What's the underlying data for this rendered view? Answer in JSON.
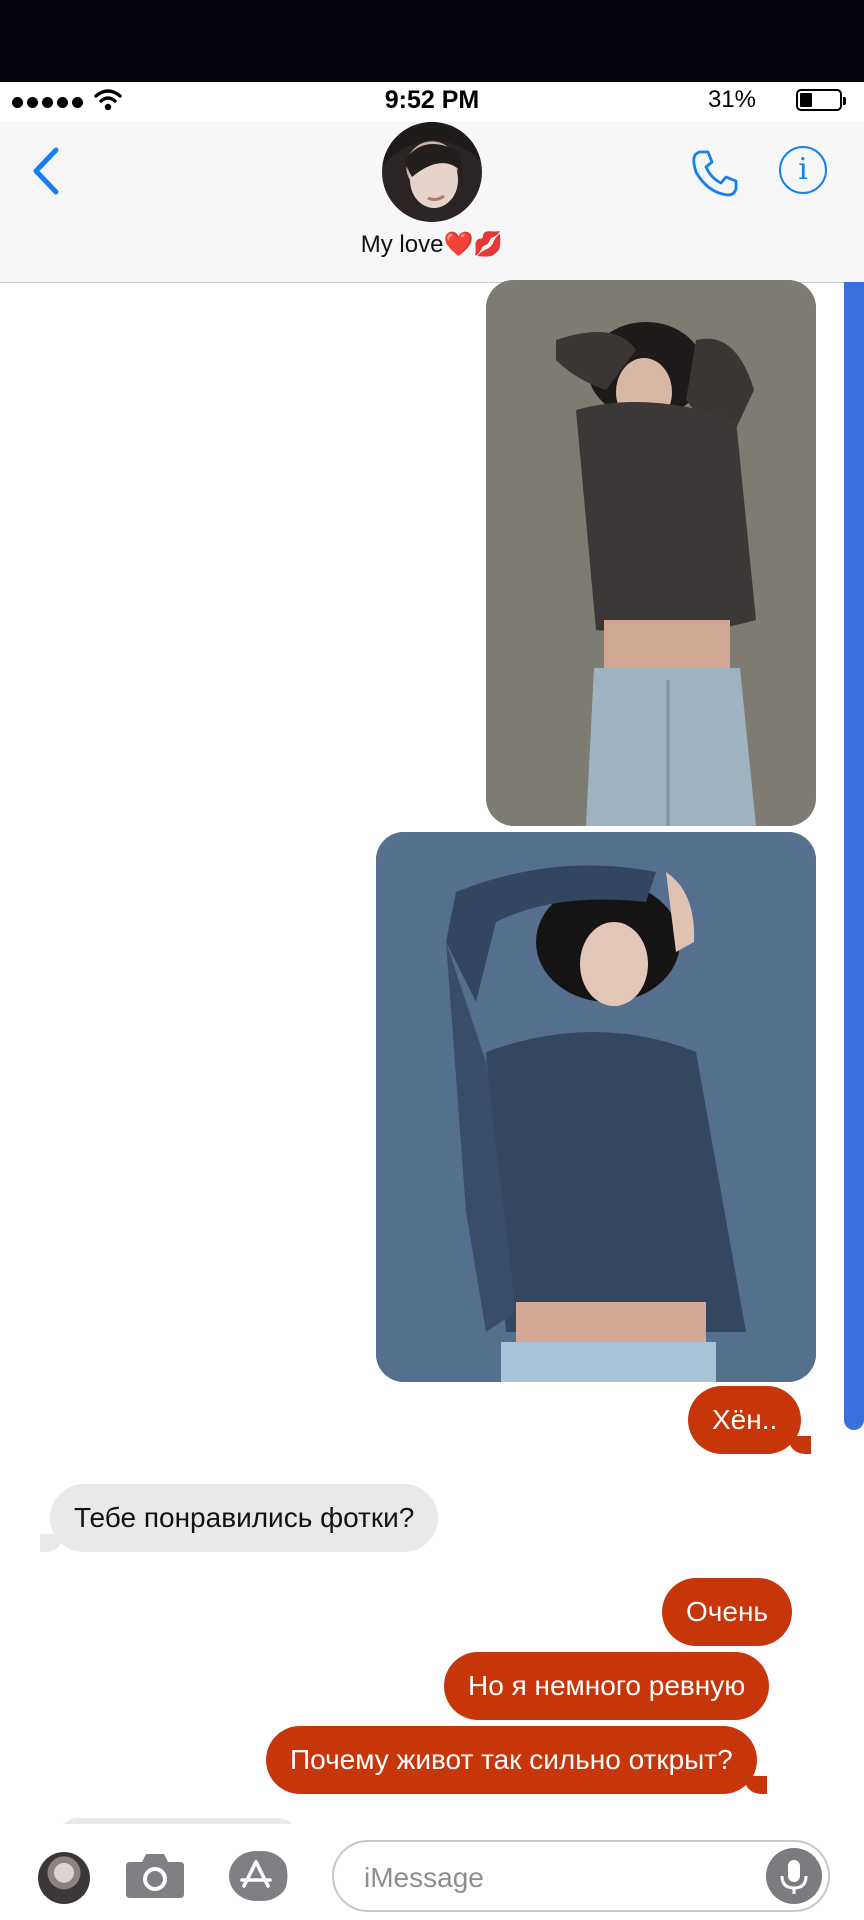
{
  "status_bar": {
    "time": "9:52 PM",
    "battery": "31%",
    "signal_icon": "signal-dots-icon",
    "wifi_icon": "wifi-icon",
    "battery_level": 0.31
  },
  "header": {
    "contact_name": "My love❤️💋",
    "back_icon": "chevron-left-icon",
    "call_icon": "phone-icon",
    "info_icon": "info-icon",
    "info_glyph": "i",
    "accent": "#1480f0"
  },
  "messages": [
    {
      "type": "image",
      "direction": "outgoing"
    },
    {
      "type": "image",
      "direction": "outgoing"
    },
    {
      "type": "text",
      "direction": "outgoing",
      "text": "Хён.."
    },
    {
      "type": "text",
      "direction": "incoming",
      "text": "Тебе понравились фотки?"
    },
    {
      "type": "text",
      "direction": "outgoing",
      "text": "Очень"
    },
    {
      "type": "text",
      "direction": "outgoing",
      "text": "Но я немного ревную"
    },
    {
      "type": "text",
      "direction": "outgoing",
      "text": "Почему живот так сильно открыт?"
    }
  ],
  "colors": {
    "outgoing_bubble": "#c7360b",
    "incoming_bubble": "#e9e9eb",
    "scrollbar": "#3a6fde"
  },
  "toolbar": {
    "placeholder": "iMessage",
    "camera_icon": "camera-icon",
    "apps_icon": "app-store-icon",
    "mic_icon": "microphone-icon"
  }
}
